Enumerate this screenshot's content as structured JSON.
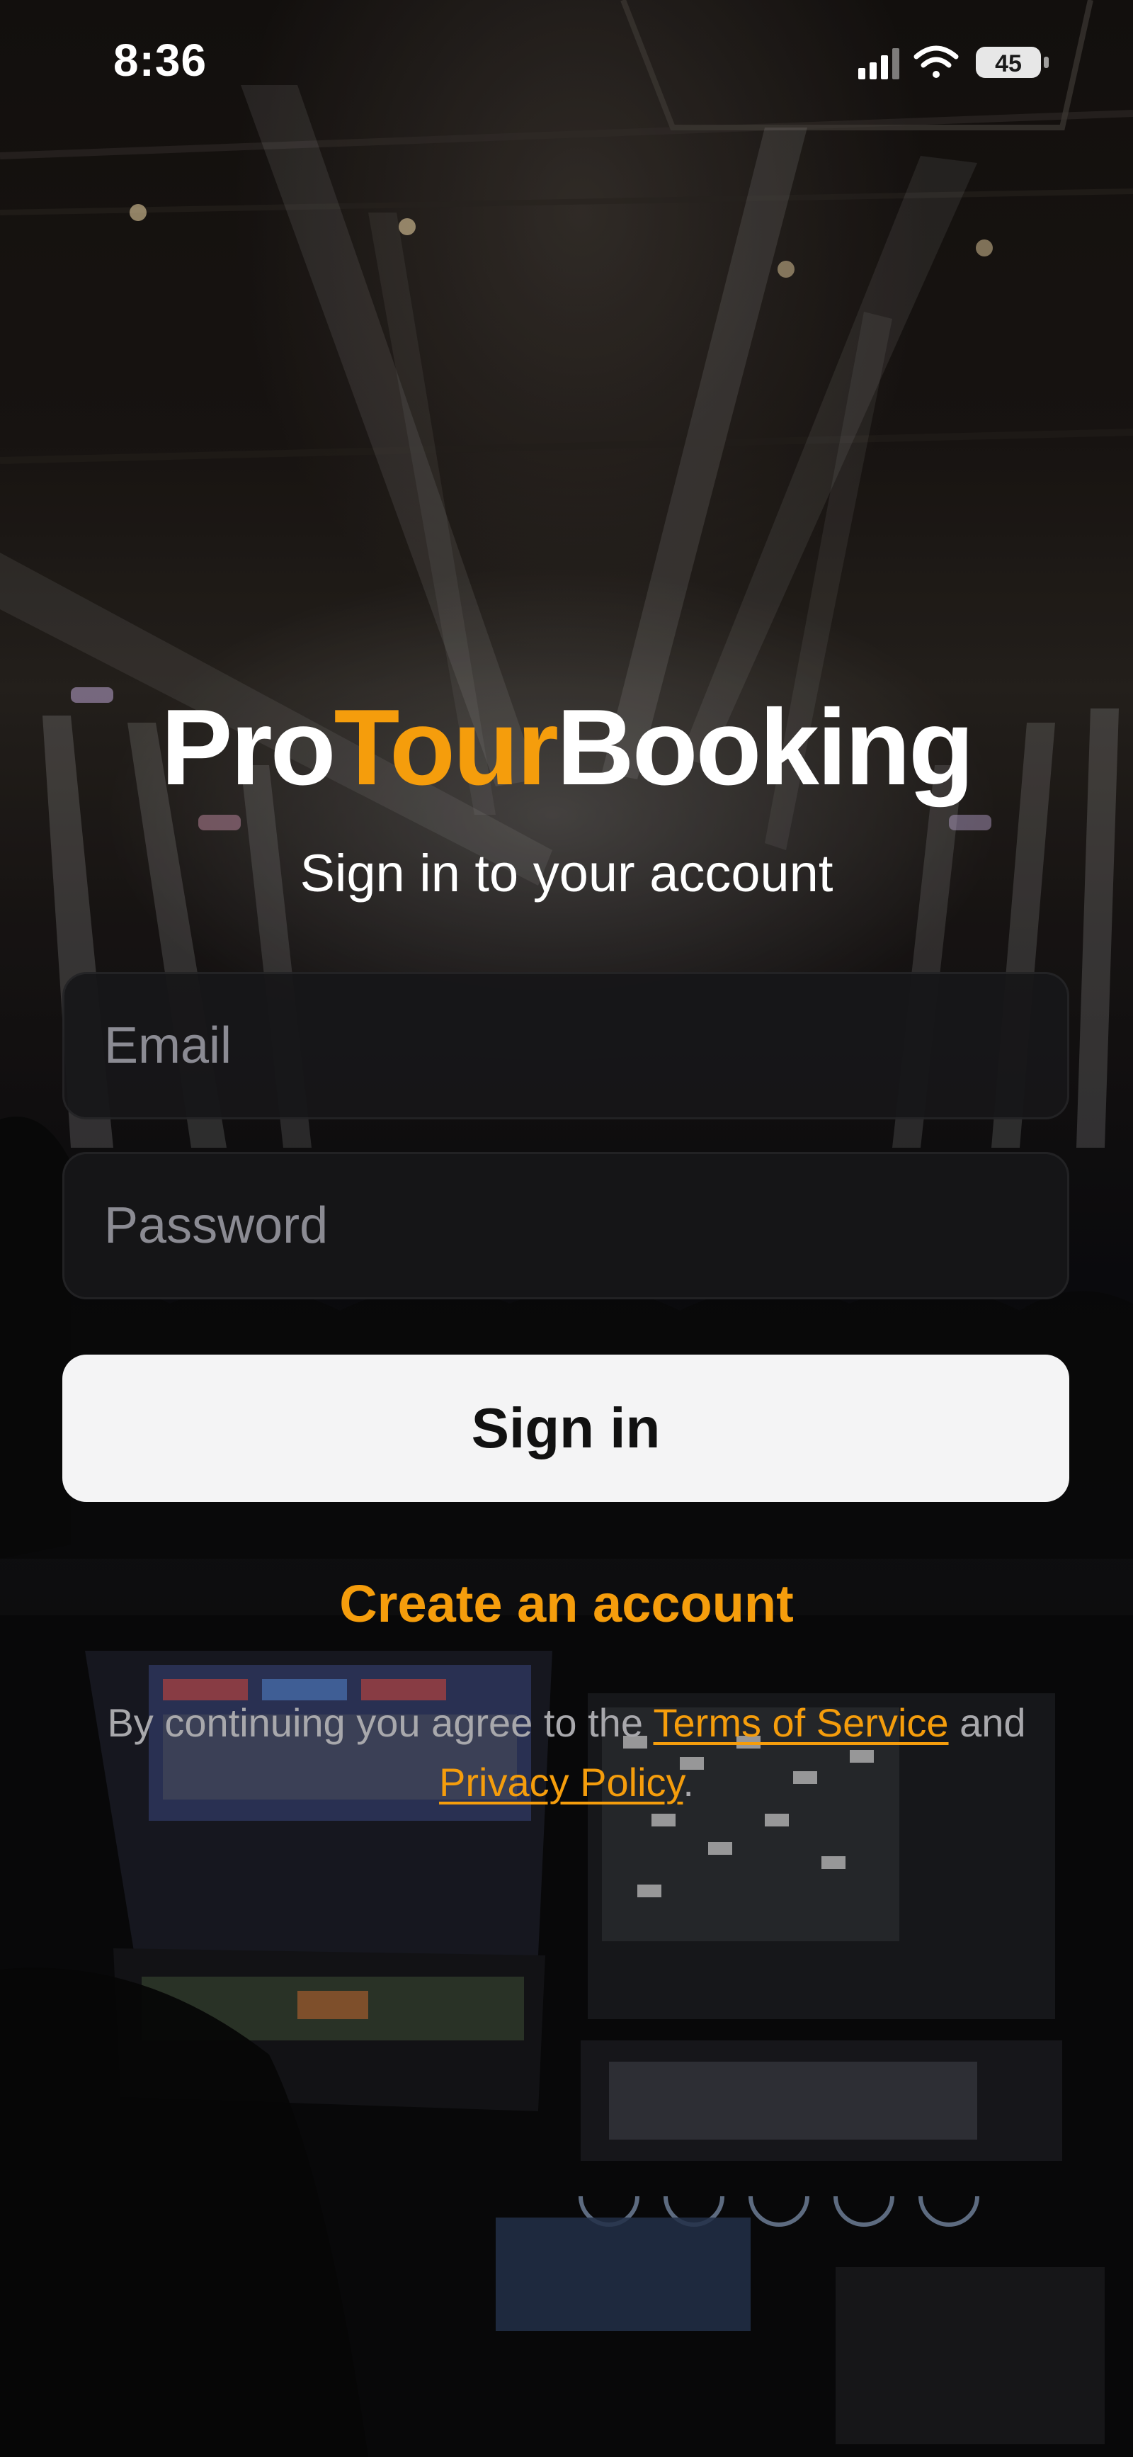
{
  "status_bar": {
    "time": "8:36",
    "battery_level": "45",
    "icons": [
      "cellular-signal-icon",
      "wifi-icon",
      "battery-icon"
    ]
  },
  "brand": {
    "part1": "Pro",
    "part2": "Tour",
    "part3": "Booking",
    "accent_color": "#f59d0c"
  },
  "subtitle": "Sign in to your account",
  "form": {
    "email_placeholder": "Email",
    "password_placeholder": "Password",
    "signin_label": "Sign in"
  },
  "create_account_label": "Create an account",
  "legal": {
    "prefix": "By continuing you agree to the ",
    "terms_label": "Terms of Service",
    "middle": " and ",
    "privacy_label": "Privacy Policy",
    "suffix": "."
  },
  "colors": {
    "accent": "#f59d0c",
    "field_background": "#161618",
    "button_background": "#f4f4f5"
  }
}
